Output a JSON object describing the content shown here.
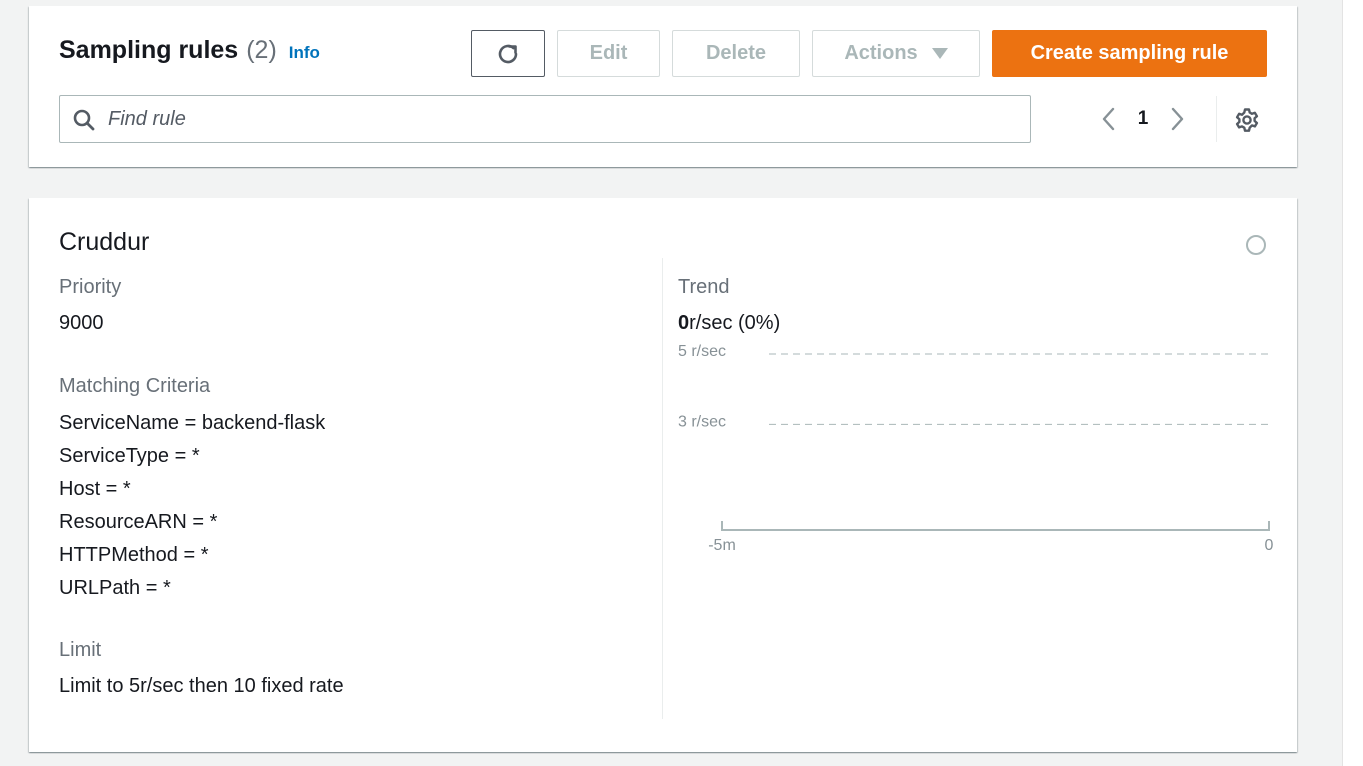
{
  "header": {
    "title": "Sampling rules",
    "count": "(2)",
    "info_label": "Info",
    "buttons": {
      "refresh_icon": "refresh-icon",
      "edit": "Edit",
      "delete": "Delete",
      "actions": "Actions",
      "create": "Create sampling rule"
    },
    "search": {
      "placeholder": "Find rule",
      "value": ""
    },
    "pagination": {
      "current_page": "1"
    },
    "accent_color": "#ec7211",
    "link_color": "#0073bb"
  },
  "rule": {
    "name": "Cruddur",
    "priority_label": "Priority",
    "priority": "9000",
    "criteria_label": "Matching Criteria",
    "criteria": [
      "ServiceName = backend-flask",
      "ServiceType = *",
      "Host = *",
      "ResourceARN = *",
      "HTTPMethod = *",
      "URLPath = *"
    ],
    "limit_label": "Limit",
    "limit": "Limit to 5r/sec then 10 fixed rate",
    "trend_label": "Trend",
    "trend_value": "0",
    "trend_suffix": "r/sec (0%)"
  },
  "chart_data": {
    "type": "line",
    "gridlines": [
      {
        "label": "5 r/sec",
        "value": 5
      },
      {
        "label": "3 r/sec",
        "value": 3
      }
    ],
    "x_ticks": [
      "-5m",
      "0"
    ],
    "series": [],
    "ylim": [
      0,
      5
    ]
  }
}
